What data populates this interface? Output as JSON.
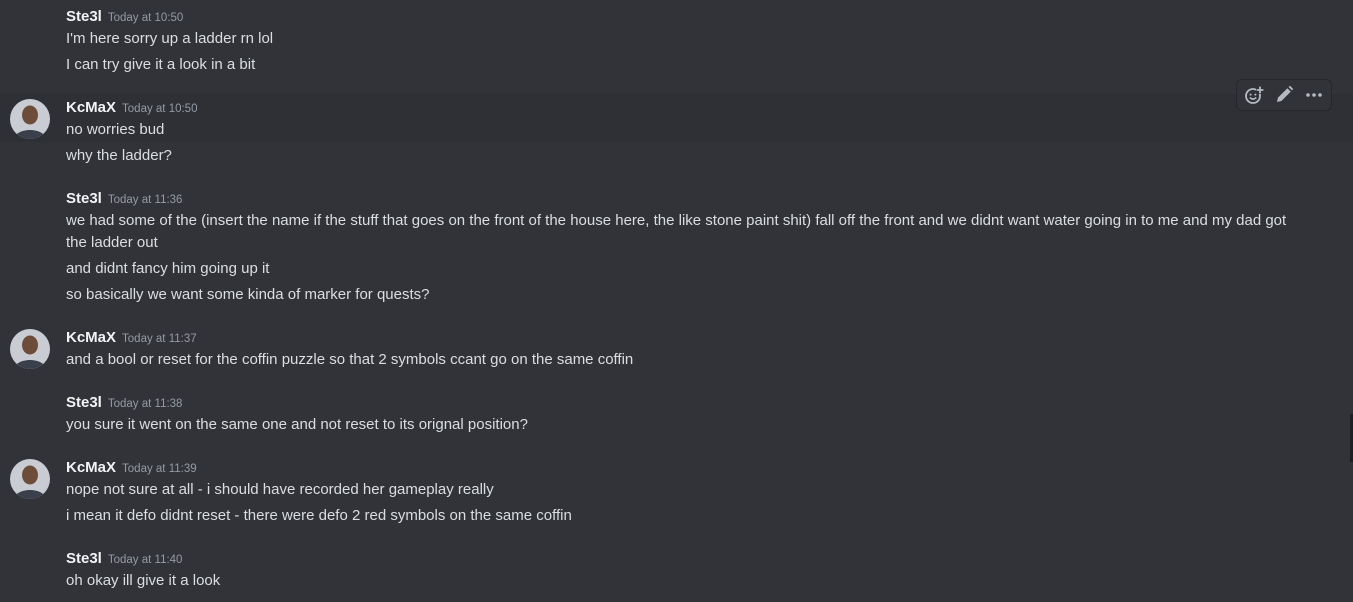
{
  "messages": [
    {
      "author": "Ste3l",
      "timestamp": "Today at 10:50",
      "lines": [
        "I'm here sorry up a ladder rn lol",
        "I can try give it a look in a bit"
      ]
    },
    {
      "author": "KcMaX",
      "timestamp": "Today at 10:50",
      "lines": [
        "no worries bud",
        "why the ladder?"
      ]
    },
    {
      "author": "Ste3l",
      "timestamp": "Today at 11:36",
      "lines": [
        "we had some of the (insert the name if the stuff that goes on the front of the house here, the like stone paint shit) fall off the front and we didnt want water going in to me and my dad got the ladder out",
        "and didnt fancy him going up it",
        "so basically we want some kinda of marker for quests?"
      ]
    },
    {
      "author": "KcMaX",
      "timestamp": "Today at 11:37",
      "lines": [
        "and a bool or reset for the coffin puzzle so that 2 symbols ccant go on the same coffin"
      ]
    },
    {
      "author": "Ste3l",
      "timestamp": "Today at 11:38",
      "lines": [
        "you sure it went on the same one and not reset to its orignal position?"
      ]
    },
    {
      "author": "KcMaX",
      "timestamp": "Today at 11:39",
      "lines": [
        "nope not sure at all - i should have recorded her gameplay really",
        "i mean it defo didnt reset - there were defo 2 red symbols on the same coffin"
      ]
    },
    {
      "author": "Ste3l",
      "timestamp": "Today at 11:40",
      "lines": [
        "oh okay ill give it a look"
      ]
    }
  ],
  "toolbar": {
    "icons": [
      "add-reaction-icon",
      "edit-pencil-icon",
      "more-options-icon"
    ]
  },
  "colors": {
    "background": "#313338",
    "hover_background": "#2e3035",
    "author": "#f2f3f5",
    "timestamp": "#949ba4",
    "message_text": "#dbdee1"
  }
}
